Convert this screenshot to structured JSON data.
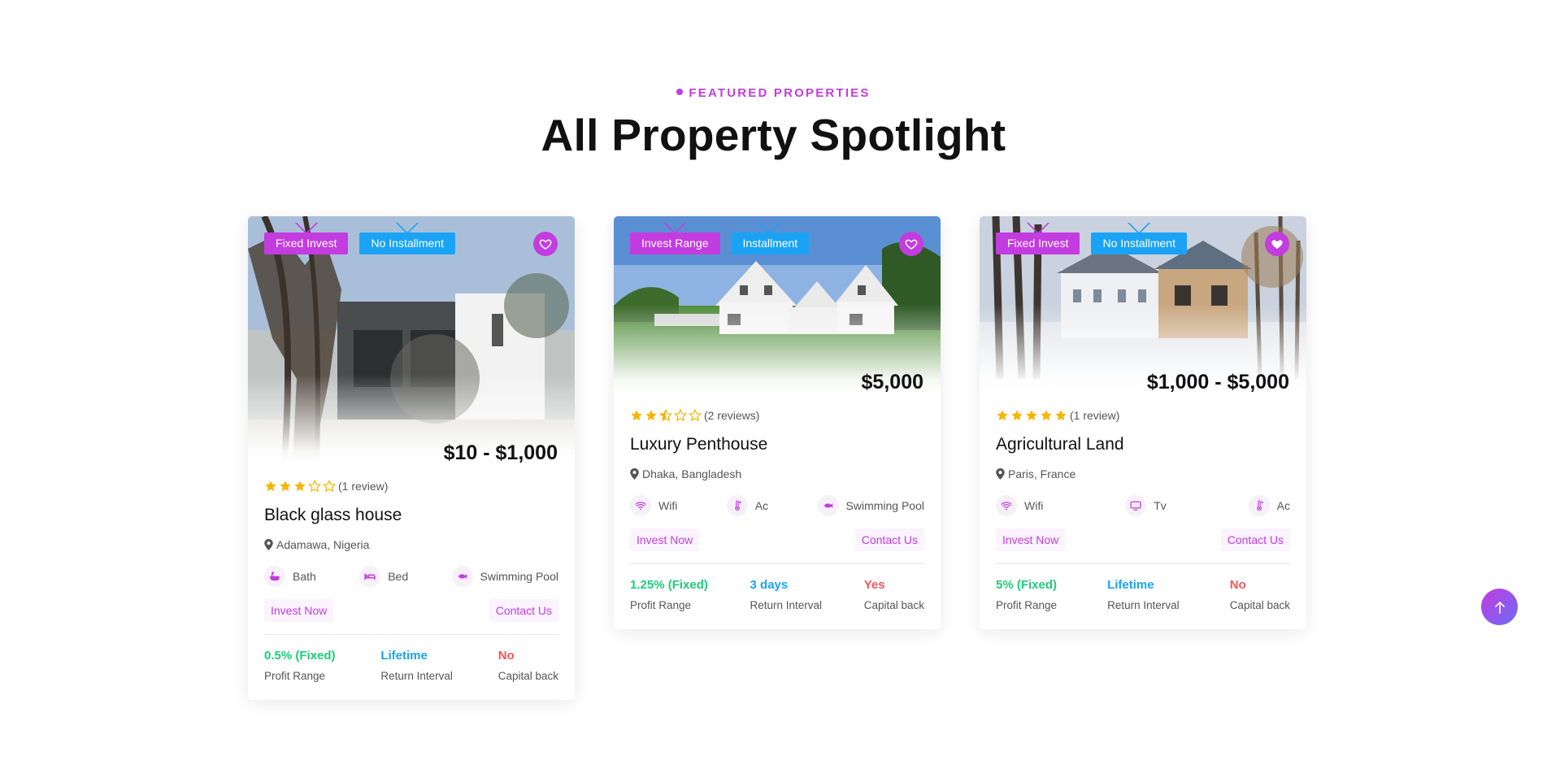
{
  "section": {
    "eyebrow": "FEATURED PROPERTIES",
    "heading": "All Property Spotlight"
  },
  "colors": {
    "accent": "#c33ce0",
    "blue": "#1aa3f5",
    "green": "#1ecb7a",
    "red": "#f5555a",
    "star": "#f7b500"
  },
  "cards": [
    {
      "badges": [
        "Fixed Invest",
        "No Installment"
      ],
      "favorite": false,
      "price": "$10 - $1,000",
      "stars": 3,
      "reviews": "(1 review)",
      "title": "Black glass house",
      "location": "Adamawa, Nigeria",
      "features": [
        {
          "icon": "bath-icon",
          "label": "Bath"
        },
        {
          "icon": "bed-icon",
          "label": "Bed"
        },
        {
          "icon": "fish-icon",
          "label": "Swimming Pool"
        }
      ],
      "invest_label": "Invest Now",
      "contact_label": "Contact Us",
      "stats": [
        {
          "value": "0.5% (Fixed)",
          "label": "Profit Range"
        },
        {
          "value": "Lifetime",
          "label": "Return Interval"
        },
        {
          "value": "No",
          "label": "Capital back"
        }
      ]
    },
    {
      "badges": [
        "Invest Range",
        "Installment"
      ],
      "favorite": false,
      "price": "$5,000",
      "stars": 2.5,
      "reviews": "(2 reviews)",
      "title": "Luxury Penthouse",
      "location": "Dhaka, Bangladesh",
      "features": [
        {
          "icon": "wifi-icon",
          "label": "Wifi"
        },
        {
          "icon": "thermometer-icon",
          "label": "Ac"
        },
        {
          "icon": "fish-icon",
          "label": "Swimming Pool"
        }
      ],
      "invest_label": "Invest Now",
      "contact_label": "Contact Us",
      "stats": [
        {
          "value": "1.25% (Fixed)",
          "label": "Profit Range"
        },
        {
          "value": "3 days",
          "label": "Return Interval"
        },
        {
          "value": "Yes",
          "label": "Capital back"
        }
      ]
    },
    {
      "badges": [
        "Fixed Invest",
        "No Installment"
      ],
      "favorite": true,
      "price": "$1,000 - $5,000",
      "stars": 5,
      "reviews": "(1 review)",
      "title": "Agricultural Land",
      "location": "Paris, France",
      "features": [
        {
          "icon": "wifi-icon",
          "label": "Wifi"
        },
        {
          "icon": "tv-icon",
          "label": "Tv"
        },
        {
          "icon": "thermometer-icon",
          "label": "Ac"
        }
      ],
      "invest_label": "Invest Now",
      "contact_label": "Contact Us",
      "stats": [
        {
          "value": "5% (Fixed)",
          "label": "Profit Range"
        },
        {
          "value": "Lifetime",
          "label": "Return Interval"
        },
        {
          "value": "No",
          "label": "Capital back"
        }
      ]
    }
  ],
  "scroll_top": {
    "icon": "arrow-up-icon"
  }
}
